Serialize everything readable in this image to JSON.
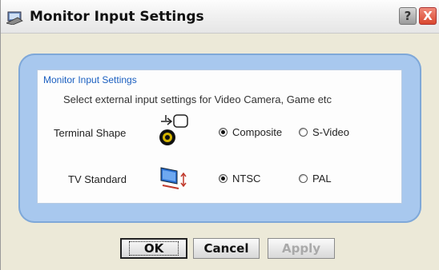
{
  "window": {
    "title": "Monitor Input Settings",
    "help_label": "?",
    "close_label": "X"
  },
  "group": {
    "title": "Monitor Input Settings",
    "description": "Select external input settings for Video Camera, Game etc"
  },
  "terminal_shape": {
    "label": "Terminal Shape",
    "icon": "composite-terminal-icon",
    "options": [
      {
        "label": "Composite",
        "checked": true
      },
      {
        "label": "S-Video",
        "checked": false
      }
    ]
  },
  "tv_standard": {
    "label": "TV Standard",
    "icon": "tv-standard-icon",
    "options": [
      {
        "label": "NTSC",
        "checked": true
      },
      {
        "label": "PAL",
        "checked": false
      }
    ]
  },
  "buttons": {
    "ok": "OK",
    "cancel": "Cancel",
    "apply": "Apply"
  },
  "colors": {
    "frame": "#a8c8ee",
    "group_title": "#1a5fc0",
    "dialog_bg": "#ece9d8"
  }
}
